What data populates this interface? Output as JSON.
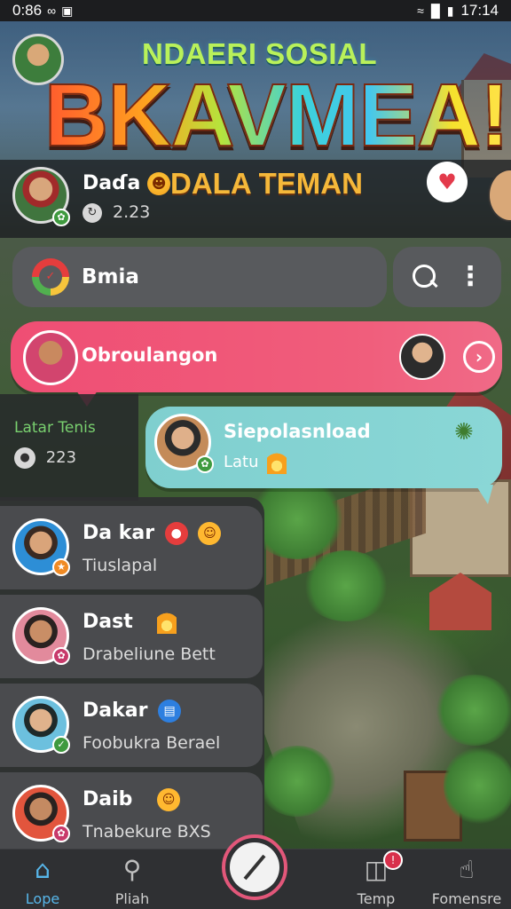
{
  "status_bar": {
    "left_time": "0:86",
    "right_time": "17:14"
  },
  "header": {
    "app_tag": "NDAERI SOSIAL",
    "big_title": "BKAVMEA!",
    "tagline": "DALA TEMAN",
    "profile": {
      "name": "Daɗa",
      "score": "2.23"
    }
  },
  "search_row": {
    "chat_label": "Bmia"
  },
  "banner_pink": {
    "label": "Obroulangon"
  },
  "left_panel": {
    "title": "Latar Tenis",
    "count": "223"
  },
  "banner_teal": {
    "name": "Siepolasnload",
    "subtitle": "Latu"
  },
  "chat_list": [
    {
      "name": "Da kar",
      "subtitle": "Tiuslapal",
      "badge_color": "#f08a24"
    },
    {
      "name": "Dast",
      "subtitle": "Drabeliune Bett",
      "badge_color": "#c83a6b"
    },
    {
      "name": "Dakar",
      "subtitle": "Foobukra Berael",
      "badge_color": "#3f9a3f"
    },
    {
      "name": "Daib",
      "subtitle": "Tnabekure BXS",
      "badge_color": "#c83a6b"
    }
  ],
  "bottom_nav": {
    "items": [
      {
        "label": "Lope",
        "icon": "home-icon"
      },
      {
        "label": "Pliah",
        "icon": "search-icon"
      },
      {
        "label": "Temp",
        "icon": "inbox-icon"
      },
      {
        "label": "Fomensre",
        "icon": "touch-icon"
      }
    ]
  },
  "colors": {
    "accent_blue": "#57b6ea",
    "pink": "#ef4e74",
    "teal": "#8ad7d6",
    "green_text": "#79d06f"
  }
}
